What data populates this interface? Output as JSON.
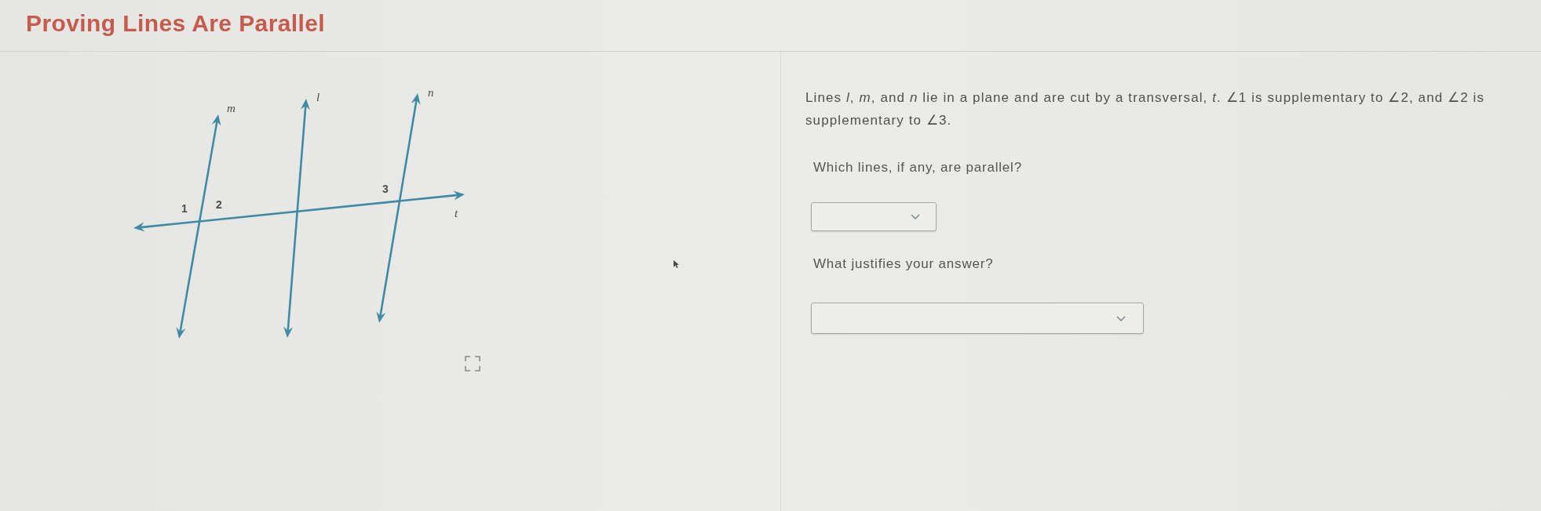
{
  "header": {
    "title": "Proving Lines Are Parallel"
  },
  "figure": {
    "lines": [
      {
        "label": "m"
      },
      {
        "label": "l"
      },
      {
        "label": "n"
      },
      {
        "label": "t"
      }
    ],
    "angle_labels": [
      "1",
      "2",
      "3"
    ]
  },
  "problem": {
    "statement": "Lines *l*, *m*, and *n* lie in a plane and are cut by a transversal, *t*. ∠1 is supplementary to ∠2, and ∠2 is supplementary to ∠3."
  },
  "questions": [
    {
      "prompt": "Which lines, if any, are parallel?"
    },
    {
      "prompt": "What justifies your answer?"
    }
  ]
}
